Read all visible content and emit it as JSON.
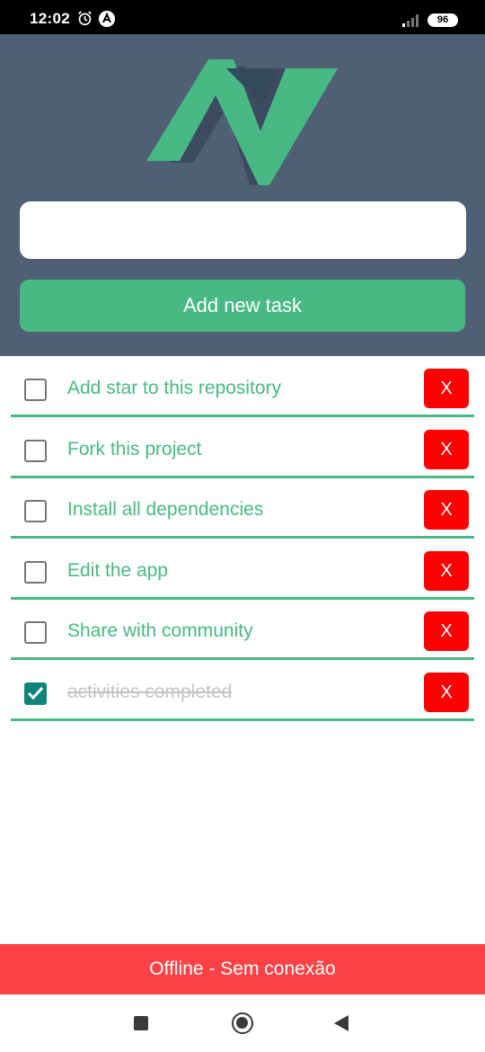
{
  "status_bar": {
    "time": "12:02",
    "battery": "96",
    "icons": [
      "alarm-icon",
      "app-notification-icon",
      "signal-icon",
      "battery-icon"
    ]
  },
  "header": {
    "logo": "vue-logo",
    "input": {
      "value": "",
      "placeholder": ""
    },
    "add_button_label": "Add new task"
  },
  "colors": {
    "header_bg": "#4f5f74",
    "accent": "#48b984",
    "delete": "#fe0000",
    "checked": "#0f8579",
    "offline_bg": "#fd4245"
  },
  "tasks": [
    {
      "label": "Add star to this repository",
      "done": false,
      "delete_label": "X"
    },
    {
      "label": "Fork this project",
      "done": false,
      "delete_label": "X"
    },
    {
      "label": "Install all dependencies",
      "done": false,
      "delete_label": "X"
    },
    {
      "label": "Edit the app",
      "done": false,
      "delete_label": "X"
    },
    {
      "label": "Share with community",
      "done": false,
      "delete_label": "X"
    },
    {
      "label": "activities completed",
      "done": true,
      "delete_label": "X"
    }
  ],
  "offline_banner": "Offline - Sem conexão",
  "nav_bar": {
    "icons": [
      "recents-icon",
      "home-icon",
      "back-icon"
    ]
  }
}
